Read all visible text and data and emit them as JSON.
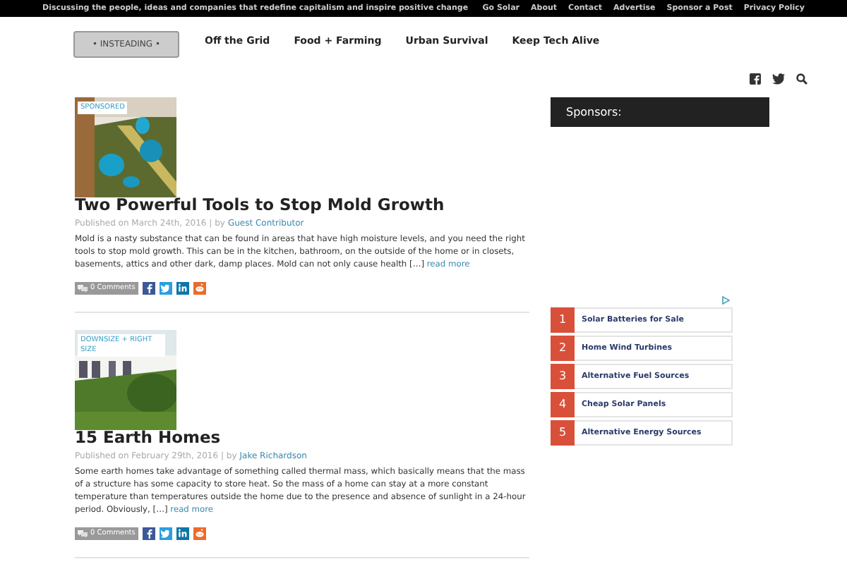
{
  "top_bar": {
    "tagline": "Discussing the people, ideas and companies that redefine capitalism and inspire positive change",
    "links": [
      "Go Solar",
      "About",
      "Contact",
      "Advertise",
      "Sponsor a Post",
      "Privacy Policy"
    ]
  },
  "header": {
    "logo": "• INSTEADING •",
    "nav": [
      "Off the Grid",
      "Food + Farming",
      "Urban Survival",
      "Keep Tech Alive"
    ]
  },
  "posts": [
    {
      "category": "SPONSORED",
      "title": "Two Powerful Tools to Stop Mold Growth",
      "published": "Published on March 24th, 2016 | by",
      "author": "Guest Contributor",
      "excerpt": "Mold is a nasty substance that can be found in areas that have high moisture levels, and you need the right tools to stop mold growth. This can be in the kitchen, bathroom, on the outside of the home or in closets, basements, attics and other dark, damp places. Mold can not only cause health […]",
      "read_more": "read more",
      "comments": "0 Comments"
    },
    {
      "category": "DOWNSIZE + RIGHT SIZE",
      "title": "15 Earth Homes",
      "published": "Published on February 29th, 2016 | by",
      "author": "Jake Richardson",
      "excerpt": "Some earth homes take advantage of something called thermal mass, which basically means that the mass of a structure has some capacity to store heat. So the mass of a home can stay at a more constant temperature than temperatures outside the home due to the presence and absence of sunlight in a 24-hour period. Obviously, […]",
      "read_more": "read more",
      "comments": "0 Comments"
    }
  ],
  "sidebar": {
    "heading": "Sponsors:",
    "ads": [
      {
        "number": "1",
        "label": "Solar Batteries for Sale"
      },
      {
        "number": "2",
        "label": "Home Wind Turbines"
      },
      {
        "number": "3",
        "label": "Alternative Fuel Sources"
      },
      {
        "number": "4",
        "label": "Cheap Solar Panels"
      },
      {
        "number": "5",
        "label": "Alternative Energy Sources"
      }
    ]
  }
}
